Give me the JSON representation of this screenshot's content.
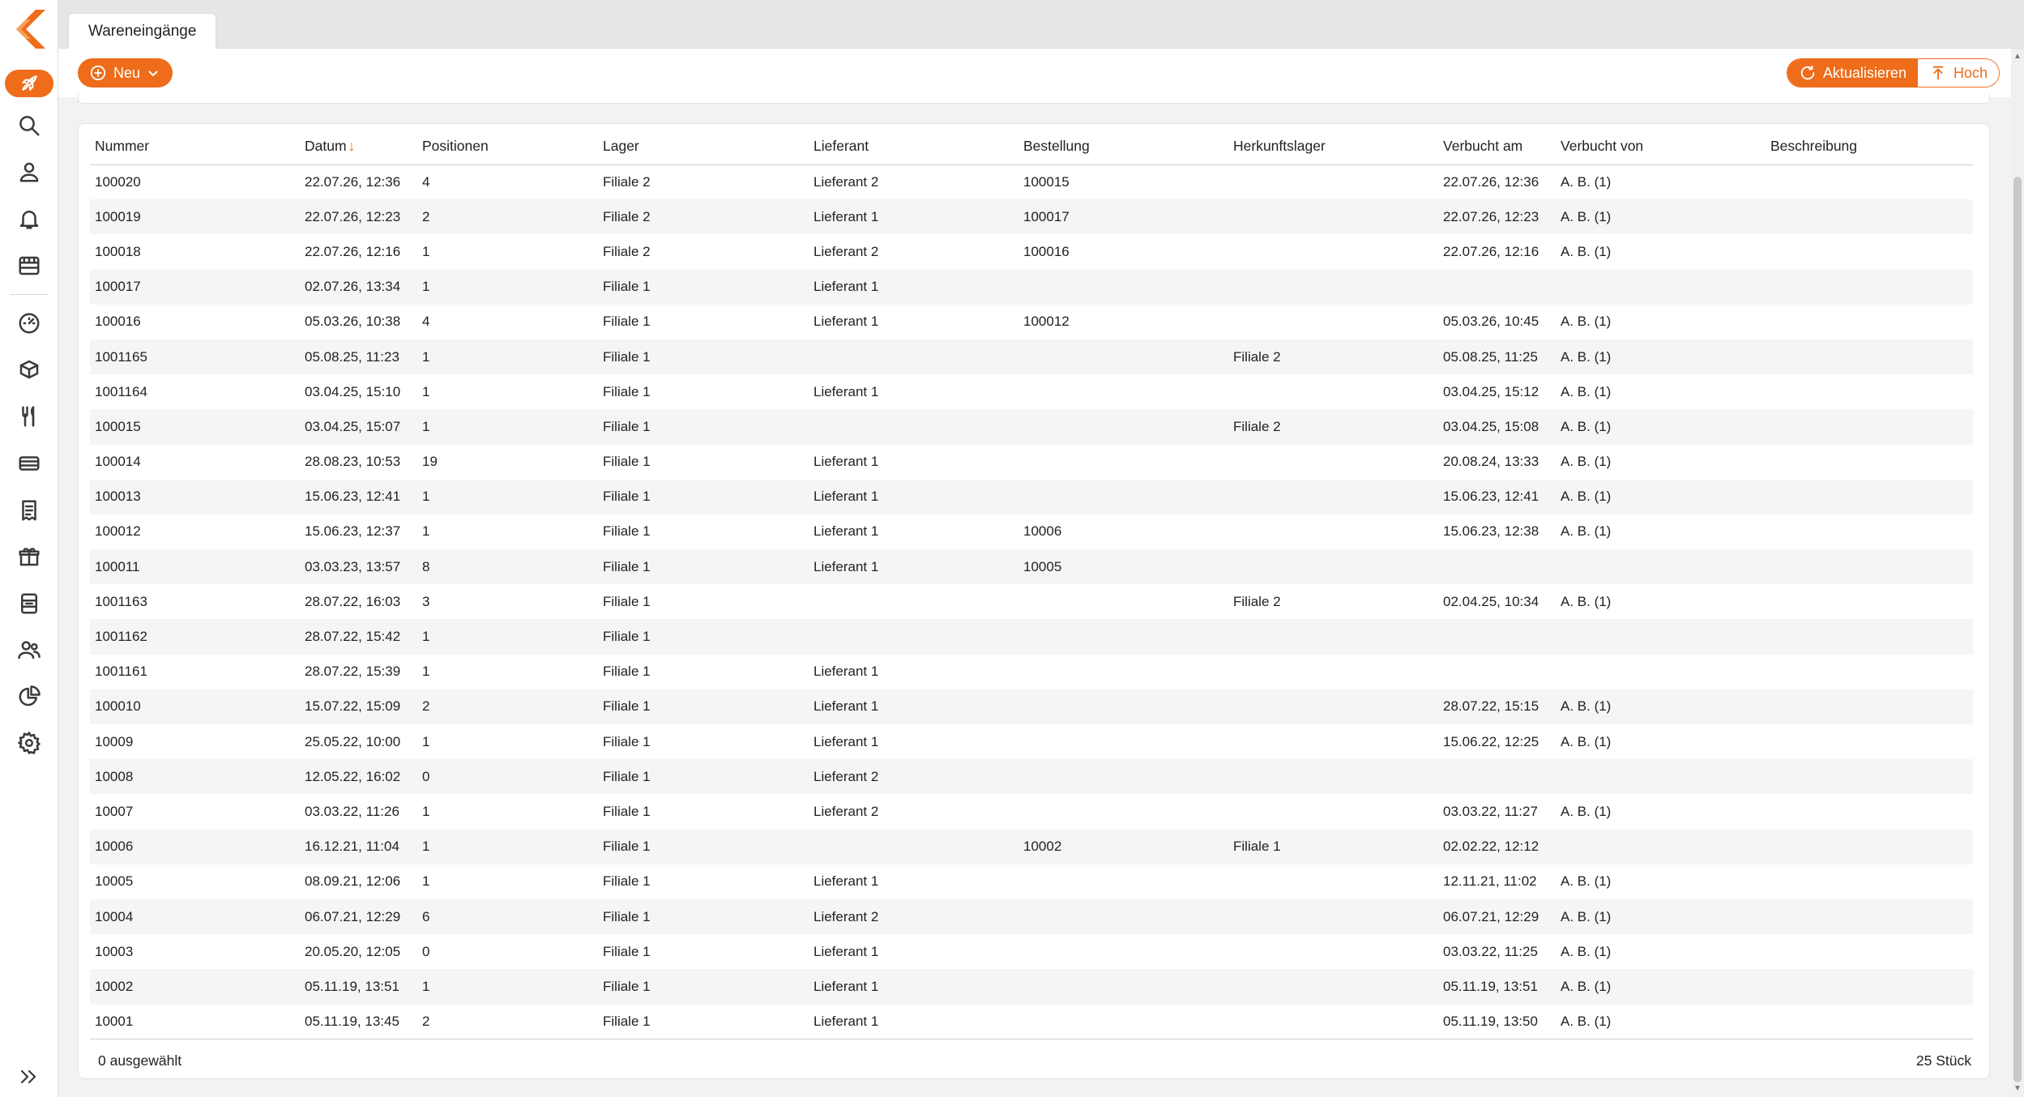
{
  "app": {
    "tab_title": "Wareneingänge"
  },
  "toolbar": {
    "new_label": "Neu",
    "refresh_label": "Aktualisieren",
    "top_label": "Hoch"
  },
  "colors": {
    "accent": "#ee6c1a"
  },
  "sidebar": {
    "icons": [
      "rocket-icon",
      "search-icon",
      "user-icon",
      "bell-icon",
      "store-icon",
      "dashboard-icon",
      "box-icon",
      "cutlery-icon",
      "ticket-icon",
      "receipt-icon",
      "gift-icon",
      "register-icon",
      "people-icon",
      "pie-chart-icon",
      "gear-icon"
    ],
    "expand_icon": "double-chevron-right-icon"
  },
  "table": {
    "columns": [
      "Nummer",
      "Datum",
      "Positionen",
      "Lager",
      "Lieferant",
      "Bestellung",
      "Herkunftslager",
      "Verbucht am",
      "Verbucht von",
      "Beschreibung"
    ],
    "sort_column": "Datum",
    "sort_icon": "arrow-down-icon",
    "rows": [
      [
        "100020",
        "22.07.26, 12:36",
        "4",
        "Filiale 2",
        "Lieferant 2",
        "100015",
        "",
        "22.07.26, 12:36",
        "A. B. (1)",
        ""
      ],
      [
        "100019",
        "22.07.26, 12:23",
        "2",
        "Filiale 2",
        "Lieferant 1",
        "100017",
        "",
        "22.07.26, 12:23",
        "A. B. (1)",
        ""
      ],
      [
        "100018",
        "22.07.26, 12:16",
        "1",
        "Filiale 2",
        "Lieferant 2",
        "100016",
        "",
        "22.07.26, 12:16",
        "A. B. (1)",
        ""
      ],
      [
        "100017",
        "02.07.26, 13:34",
        "1",
        "Filiale 1",
        "Lieferant 1",
        "",
        "",
        "",
        "",
        ""
      ],
      [
        "100016",
        "05.03.26, 10:38",
        "4",
        "Filiale 1",
        "Lieferant 1",
        "100012",
        "",
        "05.03.26, 10:45",
        "A. B. (1)",
        ""
      ],
      [
        "1001165",
        "05.08.25, 11:23",
        "1",
        "Filiale 1",
        "",
        "",
        "Filiale 2",
        "05.08.25, 11:25",
        "A. B. (1)",
        ""
      ],
      [
        "1001164",
        "03.04.25, 15:10",
        "1",
        "Filiale 1",
        "Lieferant 1",
        "",
        "",
        "03.04.25, 15:12",
        "A. B. (1)",
        ""
      ],
      [
        "100015",
        "03.04.25, 15:07",
        "1",
        "Filiale 1",
        "",
        "",
        "Filiale 2",
        "03.04.25, 15:08",
        "A. B. (1)",
        ""
      ],
      [
        "100014",
        "28.08.23, 10:53",
        "19",
        "Filiale 1",
        "Lieferant 1",
        "",
        "",
        "20.08.24, 13:33",
        "A. B. (1)",
        ""
      ],
      [
        "100013",
        "15.06.23, 12:41",
        "1",
        "Filiale 1",
        "Lieferant 1",
        "",
        "",
        "15.06.23, 12:41",
        "A. B. (1)",
        ""
      ],
      [
        "100012",
        "15.06.23, 12:37",
        "1",
        "Filiale 1",
        "Lieferant 1",
        "10006",
        "",
        "15.06.23, 12:38",
        "A. B. (1)",
        ""
      ],
      [
        "100011",
        "03.03.23, 13:57",
        "8",
        "Filiale 1",
        "Lieferant 1",
        "10005",
        "",
        "",
        "",
        ""
      ],
      [
        "1001163",
        "28.07.22, 16:03",
        "3",
        "Filiale 1",
        "",
        "",
        "Filiale 2",
        "02.04.25, 10:34",
        "A. B. (1)",
        ""
      ],
      [
        "1001162",
        "28.07.22, 15:42",
        "1",
        "Filiale 1",
        "",
        "",
        "",
        "",
        "",
        ""
      ],
      [
        "1001161",
        "28.07.22, 15:39",
        "1",
        "Filiale 1",
        "Lieferant 1",
        "",
        "",
        "",
        "",
        ""
      ],
      [
        "100010",
        "15.07.22, 15:09",
        "2",
        "Filiale 1",
        "Lieferant 1",
        "",
        "",
        "28.07.22, 15:15",
        "A. B. (1)",
        ""
      ],
      [
        "10009",
        "25.05.22, 10:00",
        "1",
        "Filiale 1",
        "Lieferant 1",
        "",
        "",
        "15.06.22, 12:25",
        "A. B. (1)",
        ""
      ],
      [
        "10008",
        "12.05.22, 16:02",
        "0",
        "Filiale 1",
        "Lieferant 2",
        "",
        "",
        "",
        "",
        ""
      ],
      [
        "10007",
        "03.03.22, 11:26",
        "1",
        "Filiale 1",
        "Lieferant 2",
        "",
        "",
        "03.03.22, 11:27",
        "A. B. (1)",
        ""
      ],
      [
        "10006",
        "16.12.21, 11:04",
        "1",
        "Filiale 1",
        "",
        "10002",
        "Filiale 1",
        "02.02.22, 12:12",
        "",
        ""
      ],
      [
        "10005",
        "08.09.21, 12:06",
        "1",
        "Filiale 1",
        "Lieferant 1",
        "",
        "",
        "12.11.21, 11:02",
        "A. B. (1)",
        ""
      ],
      [
        "10004",
        "06.07.21, 12:29",
        "6",
        "Filiale 1",
        "Lieferant 2",
        "",
        "",
        "06.07.21, 12:29",
        "A. B. (1)",
        ""
      ],
      [
        "10003",
        "20.05.20, 12:05",
        "0",
        "Filiale 1",
        "Lieferant 1",
        "",
        "",
        "03.03.22, 11:25",
        "A. B. (1)",
        ""
      ],
      [
        "10002",
        "05.11.19, 13:51",
        "1",
        "Filiale 1",
        "Lieferant 1",
        "",
        "",
        "05.11.19, 13:51",
        "A. B. (1)",
        ""
      ],
      [
        "10001",
        "05.11.19, 13:45",
        "2",
        "Filiale 1",
        "Lieferant 1",
        "",
        "",
        "05.11.19, 13:50",
        "A. B. (1)",
        ""
      ]
    ]
  },
  "footer": {
    "selected": "0 ausgewählt",
    "count": "25 Stück"
  }
}
